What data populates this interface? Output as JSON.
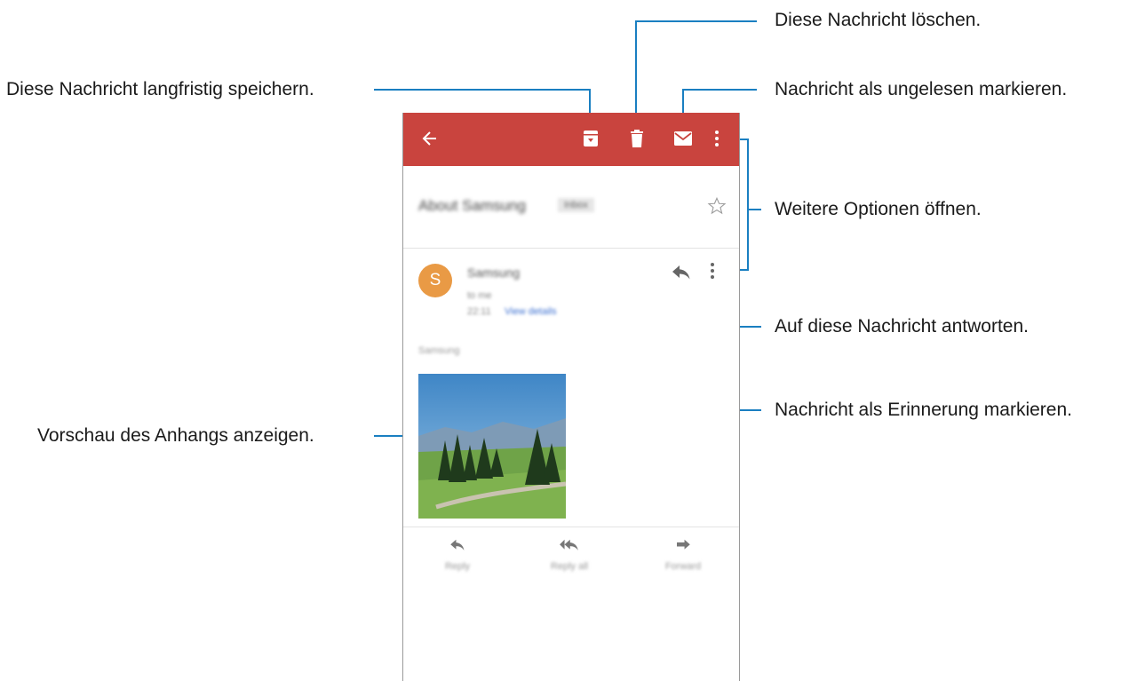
{
  "callouts": {
    "delete": "Diese Nachricht löschen.",
    "archive": "Diese Nachricht langfristig speichern.",
    "mark_unread": "Nachricht als ungelesen markieren.",
    "more_options": "Weitere Optionen öffnen.",
    "reply": "Auf diese Nachricht antworten.",
    "reminder": "Nachricht als Erinnerung markieren.",
    "preview": "Vorschau des Anhangs anzeigen."
  },
  "email": {
    "subject": "About Samsung",
    "label": "Inbox",
    "sender": "Samsung",
    "sender_initial": "S",
    "recipient": "to me",
    "time": "22:11",
    "view_details": "View details",
    "body": "Samsung"
  },
  "actions": {
    "reply": "Reply",
    "reply_all": "Reply all",
    "forward": "Forward"
  },
  "colors": {
    "appbar": "#c9443e",
    "avatar": "#e99a45",
    "link": "#3b6fd0",
    "callout_line": "#1a7fc1"
  },
  "icons": [
    "back-arrow-icon",
    "archive-icon",
    "trash-icon",
    "mail-icon",
    "more-vert-icon",
    "star-icon",
    "reply-icon",
    "reply-all-icon",
    "forward-icon"
  ]
}
